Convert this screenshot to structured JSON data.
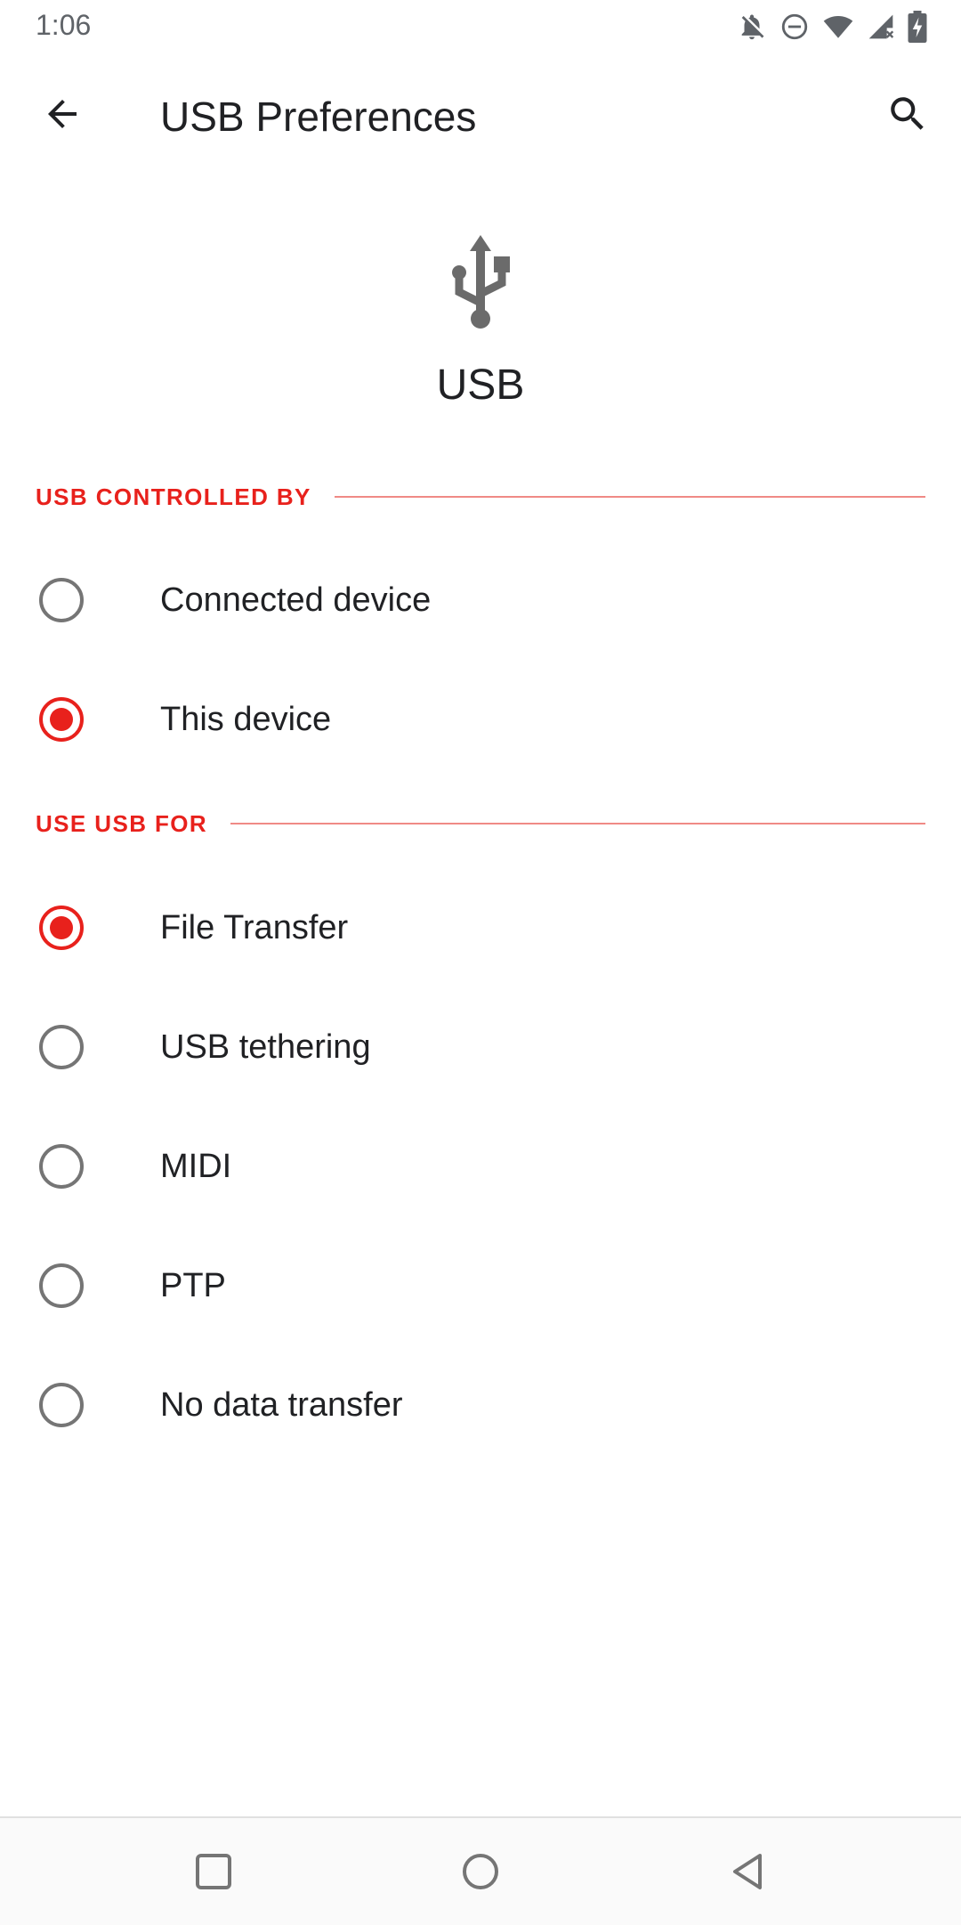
{
  "status_bar": {
    "time": "1:06",
    "icons": [
      "notifications-off-icon",
      "do-not-disturb-icon",
      "wifi-icon",
      "cell-signal-icon",
      "battery-charging-icon"
    ]
  },
  "app_bar": {
    "title": "USB Preferences",
    "back_icon": "back-arrow-icon",
    "search_icon": "search-icon"
  },
  "header": {
    "icon": "usb-icon",
    "title": "USB"
  },
  "sections": [
    {
      "label": "USB CONTROLLED BY",
      "options": [
        {
          "label": "Connected device",
          "checked": false
        },
        {
          "label": "This device",
          "checked": true
        }
      ]
    },
    {
      "label": "USE USB FOR",
      "options": [
        {
          "label": "File Transfer",
          "checked": true
        },
        {
          "label": "USB tethering",
          "checked": false
        },
        {
          "label": "MIDI",
          "checked": false
        },
        {
          "label": "PTP",
          "checked": false
        },
        {
          "label": "No data transfer",
          "checked": false
        }
      ]
    }
  ],
  "nav_bar": {
    "icons": [
      "recents-icon",
      "home-icon",
      "back-icon"
    ]
  },
  "colors": {
    "accent": "#e8211c",
    "text": "#202124",
    "radio_unchecked": "#757575"
  }
}
